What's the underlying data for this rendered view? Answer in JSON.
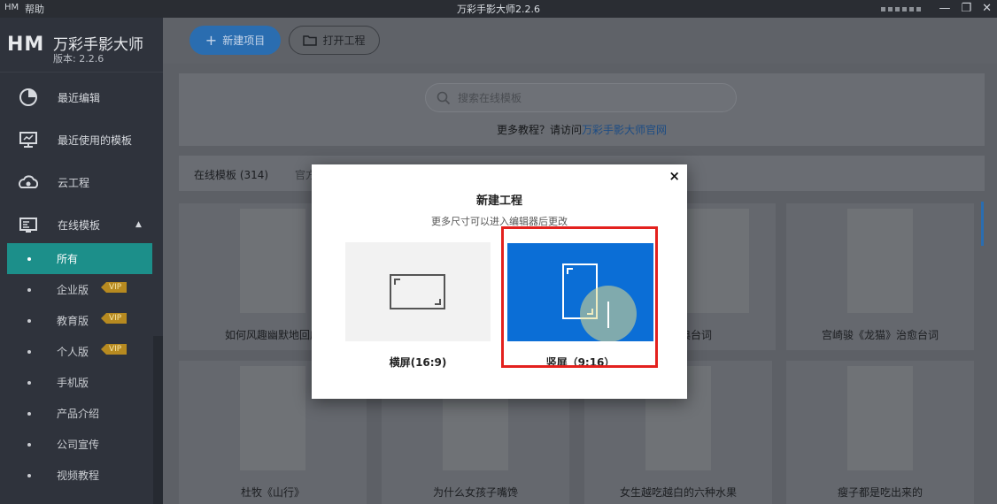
{
  "titlebar": {
    "app_icon": "HM",
    "menu_help": "帮助",
    "title": "万彩手影大师2.2.6",
    "minimize": "—",
    "restore": "❐",
    "close": "✕"
  },
  "sidebar": {
    "logo_mark": "HM",
    "app_name": "万彩手影大师",
    "version": "版本: 2.2.6",
    "items": [
      {
        "label": "最近编辑",
        "icon": "clock-pie-icon"
      },
      {
        "label": "最近使用的模板",
        "icon": "monitor-icon"
      },
      {
        "label": "云工程",
        "icon": "cloud-icon"
      },
      {
        "label": "在线模板",
        "icon": "template-icon"
      }
    ],
    "sub_items": [
      {
        "label": "所有",
        "vip": ""
      },
      {
        "label": "企业版",
        "vip": "VIP"
      },
      {
        "label": "教育版",
        "vip": "VIP"
      },
      {
        "label": "个人版",
        "vip": "VIP"
      },
      {
        "label": "手机版",
        "vip": ""
      },
      {
        "label": "产品介绍",
        "vip": ""
      },
      {
        "label": "公司宣传",
        "vip": ""
      },
      {
        "label": "视频教程",
        "vip": ""
      }
    ]
  },
  "toolbar": {
    "new_project": "新建项目",
    "open_project": "打开工程"
  },
  "search": {
    "placeholder": "搜索在线模板",
    "tutorial_prefix": "更多教程？请访问",
    "tutorial_link": "万彩手影大师官网"
  },
  "filter": {
    "count": "在线模板 (314)",
    "tag": "官方教"
  },
  "cards": [
    {
      "title": "如何风趣幽默地回应"
    },
    {
      "title": ""
    },
    {
      "title": ""
    },
    {
      "title": "经典台词"
    },
    {
      "title": "宫崎骏《龙猫》治愈台词"
    },
    {
      "title": "杜牧《山行》"
    },
    {
      "title": "为什么女孩子嘴馋"
    },
    {
      "title": "女生越吃越白的六种水果"
    },
    {
      "title": "瘦子都是吃出来的"
    }
  ],
  "modal": {
    "title": "新建工程",
    "subtitle": "更多尺寸可以进入编辑器后更改",
    "close": "×",
    "landscape_label": "横屏(16:9)",
    "portrait_label": "竖屏（9:16）"
  },
  "colors": {
    "accent_blue": "#0b6ed6",
    "active_teal": "#1c8f8a",
    "highlight_red": "#e3211e",
    "vip_gold": "#b78a20"
  }
}
